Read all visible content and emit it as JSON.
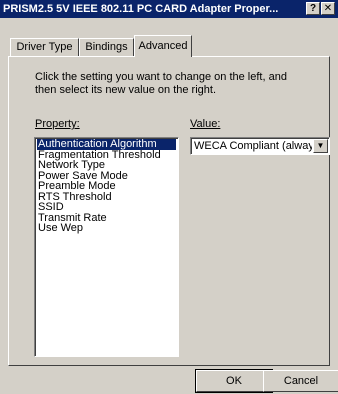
{
  "window": {
    "title": "PRISM2.5 5V IEEE 802.11 PC CARD Adapter Proper...",
    "help_label": "?",
    "close_label": "✕"
  },
  "tabs": [
    {
      "label": "Driver Type",
      "active": false
    },
    {
      "label": "Bindings",
      "active": false
    },
    {
      "label": "Advanced",
      "active": true
    }
  ],
  "instructions": "Click the setting you want to change on the left, and then select its new value on the right.",
  "property": {
    "label": "Property:",
    "items": [
      "Authentication Algorithm",
      "Fragmentation Threshold",
      "Network Type",
      "Power Save Mode",
      "Preamble Mode",
      "RTS Threshold",
      "SSID",
      "Transmit Rate",
      "Use Wep"
    ],
    "selected_index": 0
  },
  "value": {
    "label": "Value:",
    "selected": "WECA Compliant (always"
  },
  "buttons": {
    "ok": "OK",
    "cancel": "Cancel"
  }
}
